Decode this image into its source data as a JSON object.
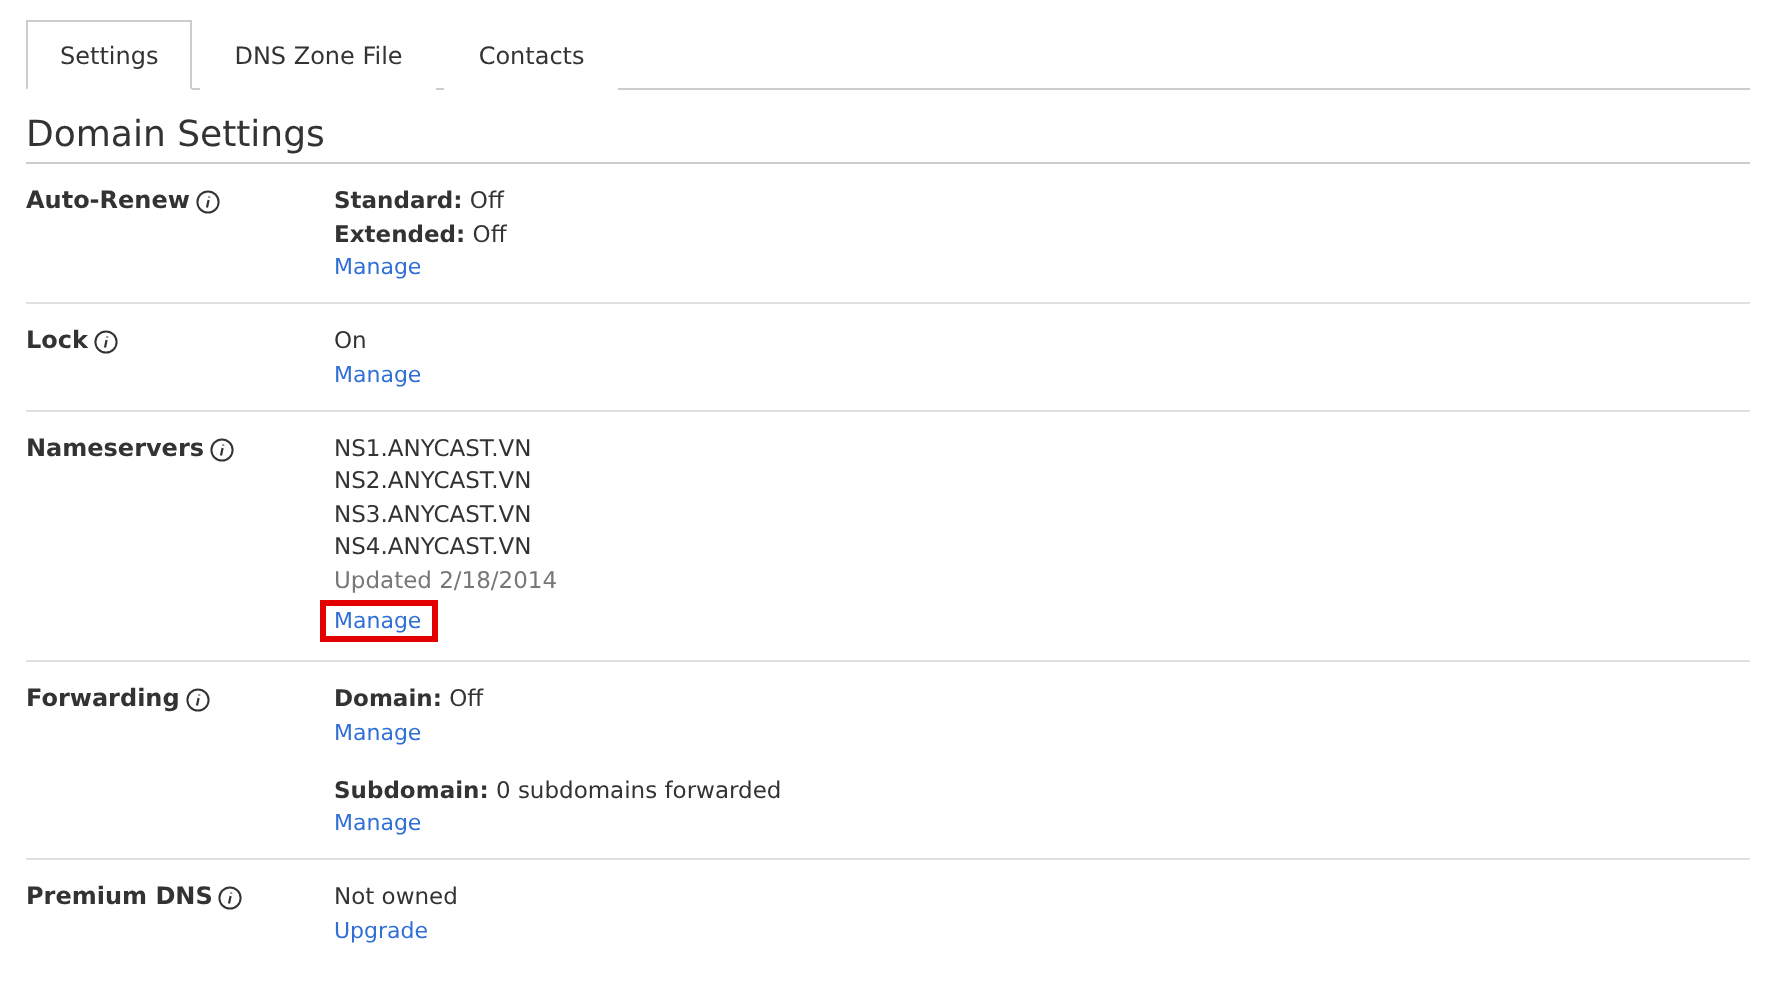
{
  "tabs": [
    {
      "label": "Settings",
      "selected": true
    },
    {
      "label": "DNS Zone File",
      "selected": false
    },
    {
      "label": "Contacts",
      "selected": false
    }
  ],
  "heading": "Domain Settings",
  "settings": [
    {
      "label": "Auto-Renew",
      "groups": [
        [
          {
            "kind": "pair",
            "key": "Standard:",
            "value": "Off"
          },
          {
            "kind": "pair",
            "key": "Extended:",
            "value": "Off"
          },
          {
            "kind": "link",
            "text": "Manage",
            "highlighted": false
          }
        ]
      ]
    },
    {
      "label": "Lock",
      "groups": [
        [
          {
            "kind": "text",
            "text": "On"
          },
          {
            "kind": "link",
            "text": "Manage",
            "highlighted": false
          }
        ]
      ]
    },
    {
      "label": "Nameservers",
      "groups": [
        [
          {
            "kind": "text",
            "text": "NS1.ANYCAST.VN"
          },
          {
            "kind": "text",
            "text": "NS2.ANYCAST.VN"
          },
          {
            "kind": "text",
            "text": "NS3.ANYCAST.VN"
          },
          {
            "kind": "text",
            "text": "NS4.ANYCAST.VN"
          },
          {
            "kind": "note",
            "text": "Updated 2/18/2014"
          },
          {
            "kind": "link",
            "text": "Manage",
            "highlighted": true
          }
        ]
      ]
    },
    {
      "label": "Forwarding",
      "groups": [
        [
          {
            "kind": "pair",
            "key": "Domain:",
            "value": "Off"
          },
          {
            "kind": "link",
            "text": "Manage",
            "highlighted": false
          }
        ],
        [
          {
            "kind": "pair",
            "key": "Subdomain:",
            "value": "0 subdomains forwarded"
          },
          {
            "kind": "link",
            "text": "Manage",
            "highlighted": false
          }
        ]
      ]
    },
    {
      "label": "Premium DNS",
      "groups": [
        [
          {
            "kind": "text",
            "text": "Not owned"
          },
          {
            "kind": "link",
            "text": "Upgrade",
            "highlighted": false
          }
        ]
      ]
    }
  ]
}
